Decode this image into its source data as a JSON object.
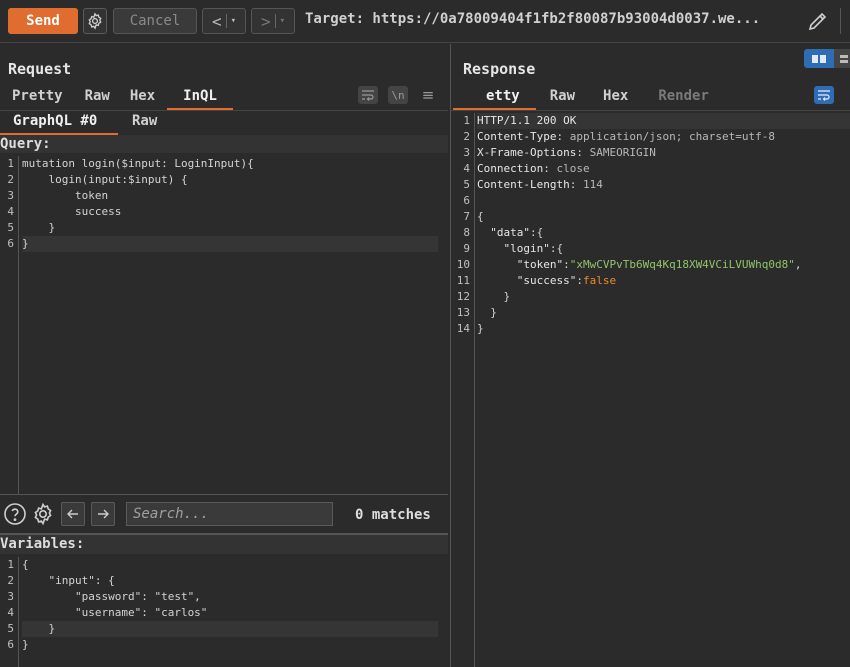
{
  "toolbar": {
    "send_label": "Send",
    "cancel_label": "Cancel",
    "back_label": "<",
    "forward_label": ">",
    "dropdown_glyph": "▾",
    "target_text": "Target: https://0a78009404f1fb2f80087b93004d0037.we..."
  },
  "request": {
    "title": "Request",
    "tabs": [
      "Pretty",
      "Raw",
      "Hex",
      "InQL"
    ],
    "active_tab": "InQL",
    "subtabs": [
      "GraphQL #0",
      "Raw"
    ],
    "active_subtab": "GraphQL #0",
    "tool_newline_label": "\\n",
    "tool_menu_label": "≡",
    "query_label": "Query:",
    "query_lines": [
      "mutation login($input: LoginInput){",
      "    login(input:$input) {",
      "        token",
      "        success",
      "    }",
      "}"
    ],
    "query_line_numbers": [
      "1",
      "2",
      "3",
      "4",
      "5",
      "6"
    ],
    "search": {
      "placeholder": "Search...",
      "matches": "0 matches"
    },
    "variables_label": "Variables:",
    "variables_lines": [
      "{",
      "    \"input\": {",
      "        \"password\": \"test\",",
      "        \"username\": \"carlos\"",
      "    }",
      "}"
    ],
    "variables_line_numbers": [
      "1",
      "2",
      "3",
      "4",
      "5",
      "6"
    ]
  },
  "response": {
    "title": "Response",
    "tabs": [
      "etty",
      "Raw",
      "Hex",
      "Render"
    ],
    "active_tab": "etty",
    "line_numbers": [
      "1",
      "2",
      "3",
      "4",
      "5",
      "6",
      "7",
      "8",
      "9",
      "10",
      "11",
      "12",
      "13",
      "14"
    ],
    "status_line": "HTTP/1.1 200 OK",
    "headers": [
      {
        "name": "Content-Type",
        "value": "application/json; charset=utf-8"
      },
      {
        "name": "X-Frame-Options",
        "value": "SAMEORIGIN"
      },
      {
        "name": "Connection",
        "value": "close"
      },
      {
        "name": "Content-Length",
        "value": "114"
      }
    ],
    "body": {
      "open_brace": "{",
      "data_key": "\"data\"",
      "login_key": "\"login\"",
      "token_key": "\"token\"",
      "token_value": "\"xMwCVPvTb6Wq4Kq18XW4VCiLVUWhq0d8\"",
      "success_key": "\"success\"",
      "success_value": "false",
      "close_brace": "}"
    }
  },
  "colors": {
    "accent": "#e06c2f",
    "string": "#8fc56a",
    "boolean": "#ee8a2f",
    "toggle_blue": "#2e6db4"
  },
  "icons": [
    "gear-icon",
    "pencil-icon",
    "help-icon",
    "arrow-left-icon",
    "arrow-right-icon",
    "wrap-icon",
    "layout-icon"
  ]
}
